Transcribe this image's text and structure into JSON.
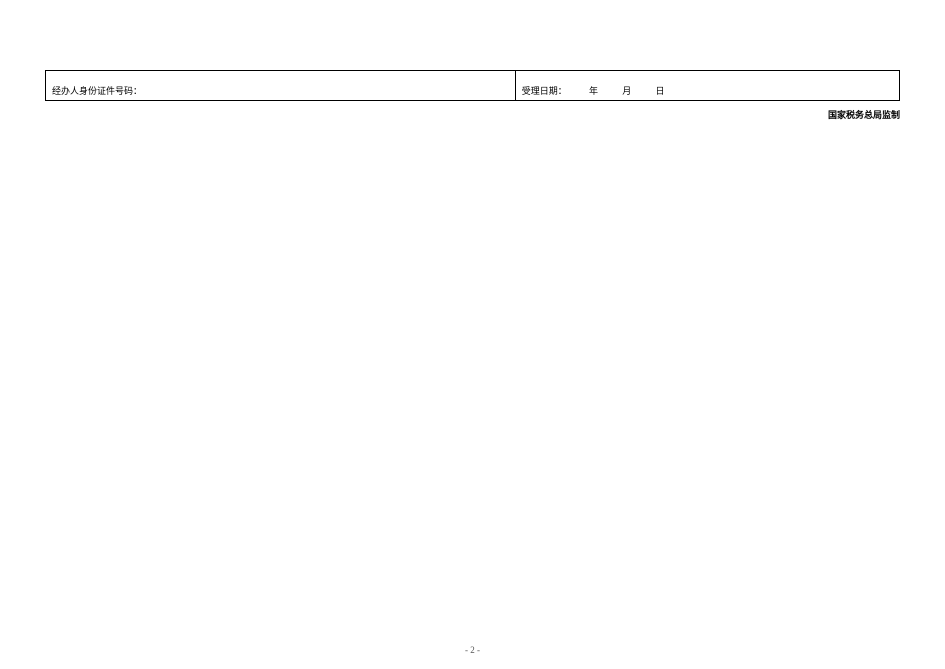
{
  "form": {
    "left_cell_label": "经办人身份证件号码：",
    "right_cell": {
      "date_label": "受理日期：",
      "year_unit": "年",
      "month_unit": "月",
      "day_unit": "日"
    }
  },
  "issuer_text": "国家税务总局监制",
  "page_number": "- 2 -"
}
